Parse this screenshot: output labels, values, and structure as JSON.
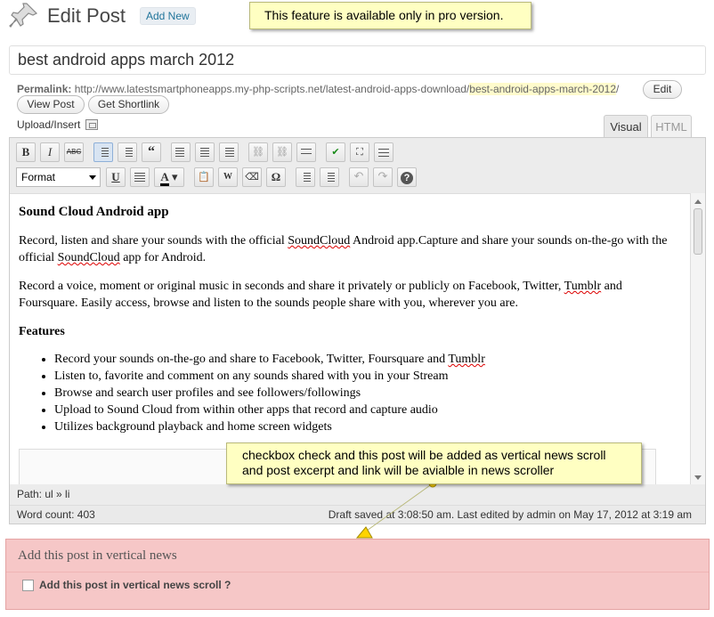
{
  "header": {
    "title": "Edit Post",
    "add_new": "Add New"
  },
  "callouts": {
    "pro_notice": "This feature is available only in pro version.",
    "news_line1": "checkbox check and this post will be added as vertical news scroll",
    "news_line2": "and post excerpt and link will be avialble in news scroller"
  },
  "post": {
    "title": "best android apps march 2012"
  },
  "permalink": {
    "label": "Permalink:",
    "base_url": "http://www.latestsmartphoneapps.my-php-scripts.net/latest-android-apps-download/",
    "slug": "best-android-apps-march-2012",
    "suffix": "/",
    "edit_label": "Edit",
    "view_post_label": "View Post",
    "shortlink_label": "Get Shortlink"
  },
  "upload": {
    "label": "Upload/Insert"
  },
  "tabs": [
    {
      "label": "Visual",
      "active": true
    },
    {
      "label": "HTML",
      "active": false
    }
  ],
  "toolbar": {
    "format_value": "Format",
    "row1": [
      "bold-icon",
      "italic-icon",
      "strikethrough-icon",
      "bullet-list-icon",
      "numbered-list-icon",
      "blockquote-icon",
      "align-left-icon",
      "align-center-icon",
      "align-right-icon",
      "link-icon",
      "unlink-icon",
      "more-tag-icon",
      "spellcheck-icon",
      "fullscreen-icon",
      "kitchen-sink-icon"
    ],
    "row2": [
      "underline-icon",
      "justify-icon",
      "text-color-icon",
      "paste-text-icon",
      "paste-word-icon",
      "clear-formatting-icon",
      "special-character-icon",
      "outdent-icon",
      "indent-icon",
      "undo-icon",
      "redo-icon",
      "help-icon"
    ]
  },
  "content": {
    "heading": "Sound Cloud Android app",
    "para1_a": "Record, listen and share your sounds with the official ",
    "para1_b": "SoundCloud",
    "para1_c": " Android app.Capture and share your sounds on-the-go with the official ",
    "para1_d": "SoundCloud",
    "para1_e": " app for Android.",
    "para2_a": "Record a voice, moment or original music in seconds and share it privately or publicly on Facebook, Twitter, ",
    "para2_b": "Tumblr",
    "para2_c": " and Foursquare. Easily access, browse and listen to the sounds people share with you, wherever you are.",
    "features_heading": "Features",
    "features": [
      " Record your sounds on-the-go and share to Facebook, Twitter, Foursquare and ",
      "Listen to, favorite and comment on any sounds shared with you in your Stream",
      "Browse and search user profiles and see followers/followings",
      "Upload to Sound Cloud from within other apps that record and capture audio",
      "Utilizes background playback and home screen widgets"
    ],
    "feature1_tail": "Tumblr"
  },
  "status": {
    "path_label": "Path:",
    "path_value": "ul » li",
    "word_count": "Word count: 403",
    "draft_saved": "Draft saved at 3:08:50 am. Last edited by admin on May 17, 2012 at 3:19 am"
  },
  "metabox": {
    "title": "Add this post in vertical news",
    "checkbox_label": "Add this post in vertical news scroll ?",
    "checked": false,
    "background_color": "#f6c7c7"
  }
}
